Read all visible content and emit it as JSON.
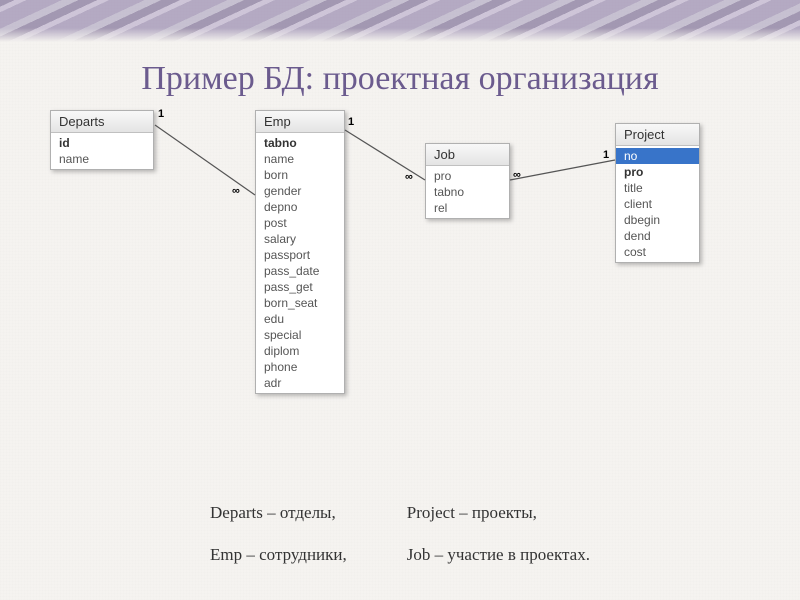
{
  "title": "Пример БД: проектная организация",
  "tables": {
    "departs": {
      "name": "Departs",
      "fields": [
        {
          "label": "id",
          "bold": true
        },
        {
          "label": "name",
          "bold": false
        }
      ]
    },
    "emp": {
      "name": "Emp",
      "fields": [
        {
          "label": "tabno",
          "bold": true
        },
        {
          "label": "name",
          "bold": false
        },
        {
          "label": "born",
          "bold": false
        },
        {
          "label": "gender",
          "bold": false
        },
        {
          "label": "depno",
          "bold": false
        },
        {
          "label": "post",
          "bold": false
        },
        {
          "label": "salary",
          "bold": false
        },
        {
          "label": "passport",
          "bold": false
        },
        {
          "label": "pass_date",
          "bold": false
        },
        {
          "label": "pass_get",
          "bold": false
        },
        {
          "label": "born_seat",
          "bold": false
        },
        {
          "label": "edu",
          "bold": false
        },
        {
          "label": "special",
          "bold": false
        },
        {
          "label": "diplom",
          "bold": false
        },
        {
          "label": "phone",
          "bold": false
        },
        {
          "label": "adr",
          "bold": false
        }
      ]
    },
    "job": {
      "name": "Job",
      "fields": [
        {
          "label": "pro",
          "bold": false
        },
        {
          "label": "tabno",
          "bold": false
        },
        {
          "label": "rel",
          "bold": false
        }
      ]
    },
    "project": {
      "name": "Project",
      "fields": [
        {
          "label": "no",
          "bold": false,
          "selected": true
        },
        {
          "label": "pro",
          "bold": true
        },
        {
          "label": "title",
          "bold": false
        },
        {
          "label": "client",
          "bold": false
        },
        {
          "label": "dbegin",
          "bold": false
        },
        {
          "label": "dend",
          "bold": false
        },
        {
          "label": "cost",
          "bold": false
        }
      ]
    }
  },
  "relations": {
    "departs_emp": {
      "from": "1",
      "to": "∞"
    },
    "emp_job": {
      "from": "1",
      "to": "∞"
    },
    "job_project": {
      "from": "∞",
      "to": "1"
    }
  },
  "legend": {
    "col1": {
      "departs": "Departs – отделы,",
      "emp": "Emp – сотрудники,"
    },
    "col2": {
      "project": "Project – проекты,",
      "job": "Job – участие в проектах."
    }
  }
}
